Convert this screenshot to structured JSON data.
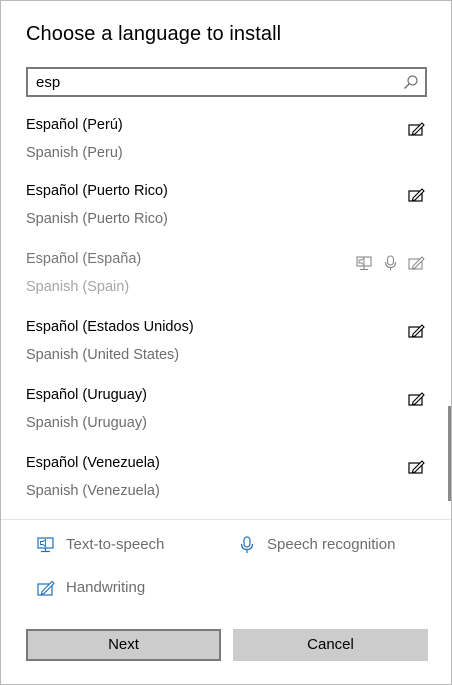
{
  "dialog": {
    "title": "Choose a language to install"
  },
  "search": {
    "value": "esp",
    "icon": "search-icon"
  },
  "languages": [
    {
      "native": "Español (Perú)",
      "english": "Spanish (Peru)",
      "enabled": true,
      "features": [
        "handwriting"
      ]
    },
    {
      "native": "Español (Puerto Rico)",
      "english": "Spanish (Puerto Rico)",
      "enabled": true,
      "features": [
        "handwriting"
      ]
    },
    {
      "native": "Español (España)",
      "english": "Spanish (Spain)",
      "enabled": false,
      "features": [
        "text-to-speech",
        "speech-recognition",
        "handwriting"
      ]
    },
    {
      "native": "Español (Estados Unidos)",
      "english": "Spanish (United States)",
      "enabled": true,
      "features": [
        "handwriting"
      ]
    },
    {
      "native": "Español (Uruguay)",
      "english": "Spanish (Uruguay)",
      "enabled": true,
      "features": [
        "handwriting"
      ]
    },
    {
      "native": "Español (Venezuela)",
      "english": "Spanish (Venezuela)",
      "enabled": true,
      "features": [
        "handwriting"
      ]
    }
  ],
  "legend": {
    "text_to_speech": "Text-to-speech",
    "speech_recognition": "Speech recognition",
    "handwriting": "Handwriting"
  },
  "buttons": {
    "next": "Next",
    "cancel": "Cancel"
  },
  "colors": {
    "legend_icon": "#1e6fb8",
    "button_bg": "#cccccc",
    "disabled_text": "#a6a6a6"
  }
}
